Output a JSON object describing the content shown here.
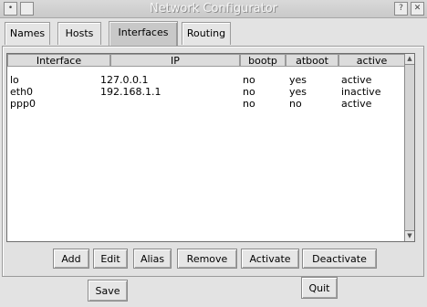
{
  "window": {
    "title": "Network Configurator",
    "menu_glyph": "•",
    "help_glyph": "?",
    "close_glyph": "✕"
  },
  "tabs": [
    {
      "label": "Names"
    },
    {
      "label": "Hosts"
    },
    {
      "label": "Interfaces",
      "active": true
    },
    {
      "label": "Routing"
    }
  ],
  "table": {
    "columns": [
      "Interface",
      "IP",
      "bootp",
      "atboot",
      "active"
    ],
    "rows": [
      {
        "interface": "lo",
        "ip": "127.0.0.1",
        "bootp": "no",
        "atboot": "yes",
        "active": "active"
      },
      {
        "interface": "eth0",
        "ip": "192.168.1.1",
        "bootp": "no",
        "atboot": "yes",
        "active": "inactive"
      },
      {
        "interface": "ppp0",
        "ip": "",
        "bootp": "no",
        "atboot": "no",
        "active": "active"
      }
    ]
  },
  "actions": {
    "add": "Add",
    "edit": "Edit",
    "alias": "Alias",
    "remove": "Remove",
    "activate": "Activate",
    "deactivate": "Deactivate"
  },
  "footer": {
    "save": "Save",
    "quit": "Quit"
  }
}
